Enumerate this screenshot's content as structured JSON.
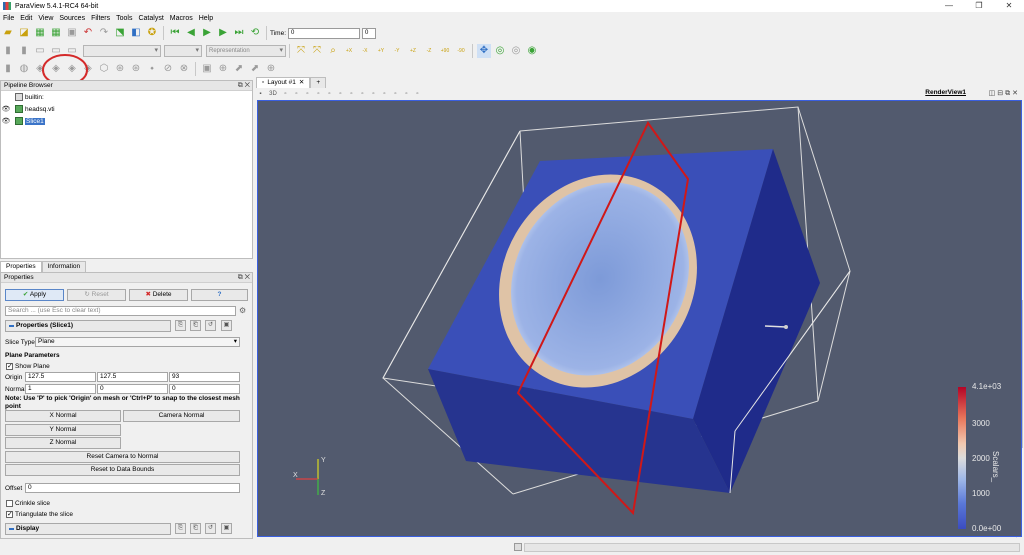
{
  "window": {
    "title": "ParaView 5.4.1-RC4 64-bit",
    "controls": [
      "—",
      "❐",
      "✕"
    ]
  },
  "menu": [
    "File",
    "Edit",
    "View",
    "Sources",
    "Filters",
    "Tools",
    "Catalyst",
    "Macros",
    "Help"
  ],
  "toolbar": {
    "time_label": "Time:",
    "time_value": "0",
    "time_step": "0",
    "representation": "Representation",
    "view_buttons": [
      "+X",
      "-X",
      "+Y",
      "-Y",
      "+Z",
      "-Z",
      "+90",
      "-90"
    ]
  },
  "pipeline": {
    "title": "Pipeline Browser",
    "items": [
      {
        "label": "builtin:",
        "kind": "server"
      },
      {
        "label": "headsq.vti",
        "kind": "source"
      },
      {
        "label": "Slice1",
        "kind": "filter",
        "selected": true
      }
    ]
  },
  "tabs": [
    "Properties",
    "Information"
  ],
  "properties": {
    "title": "Properties",
    "apply": "Apply",
    "reset": "Reset",
    "delete": "Delete",
    "help": "?",
    "search_placeholder": "Search ... (use Esc to clear text)",
    "section_title": "Properties (Slice1)",
    "slice_type_label": "Slice Type",
    "slice_type_value": "Plane",
    "plane_params": "Plane Parameters",
    "show_plane": "Show Plane",
    "origin_label": "Origin",
    "origin": [
      "127.5",
      "127.5",
      "93"
    ],
    "normal_label": "Normal",
    "normal": [
      "1",
      "0",
      "0"
    ],
    "note": "Note: Use 'P' to pick 'Origin' on mesh or 'Ctrl+P' to snap to the closest mesh point",
    "x_normal": "X Normal",
    "camera_normal": "Camera Normal",
    "y_normal": "Y Normal",
    "z_normal": "Z Normal",
    "reset_camera_normal": "Reset Camera to Normal",
    "reset_bounds": "Reset to Data Bounds",
    "offset_label": "Offset",
    "offset_value": "0",
    "crinkle": "Crinkle slice",
    "triangulate": "Triangulate the slice",
    "display": "Display"
  },
  "layout": {
    "tab_label": "Layout #1",
    "add_tab": "+",
    "view_name": "RenderView1",
    "view_3d": "3D"
  },
  "colorbar": {
    "max_label": "4.1e+03",
    "ticks": [
      "3000",
      "2000",
      "1000"
    ],
    "min_label": "0.0e+00",
    "title": "Scalars_"
  },
  "axes": {
    "x": "X",
    "y": "Y",
    "z": "Z"
  },
  "colors": {
    "render_bg": "#525a6e",
    "volume_front": "#3a4fb8",
    "volume_side": "#1f2b8a",
    "slice_red": "#d01818",
    "selection_blue": "#3b74c8"
  }
}
